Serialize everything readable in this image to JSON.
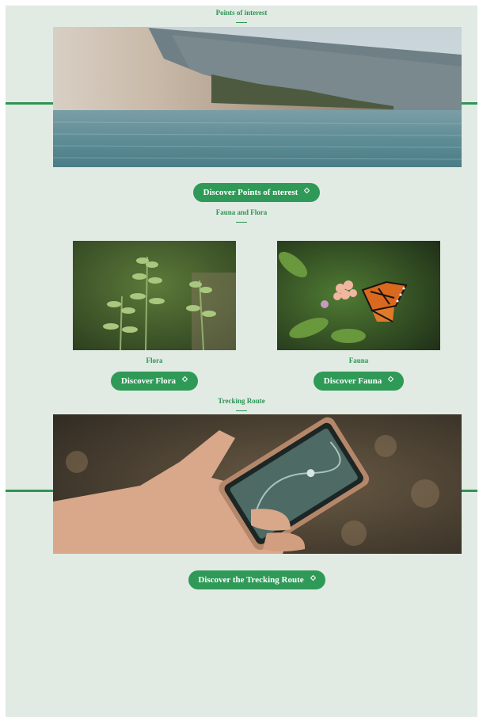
{
  "points": {
    "title": "Points of interest",
    "button_label": "Discover Points of nterest",
    "image_icon": "coastal-cliff-photo"
  },
  "fauna_flora": {
    "title": "Fauna and Flora",
    "flora": {
      "caption": "Flora",
      "button_label": "Discover Flora",
      "image_icon": "plant-photo"
    },
    "fauna": {
      "caption": "Fauna",
      "button_label": "Discover Fauna",
      "image_icon": "butterfly-photo"
    }
  },
  "route": {
    "title": "Trecking Route",
    "button_label": "Discover the Trecking Route",
    "image_icon": "phone-map-photo"
  },
  "colors": {
    "accent": "#2f9a57",
    "background": "#e1ebe4"
  }
}
